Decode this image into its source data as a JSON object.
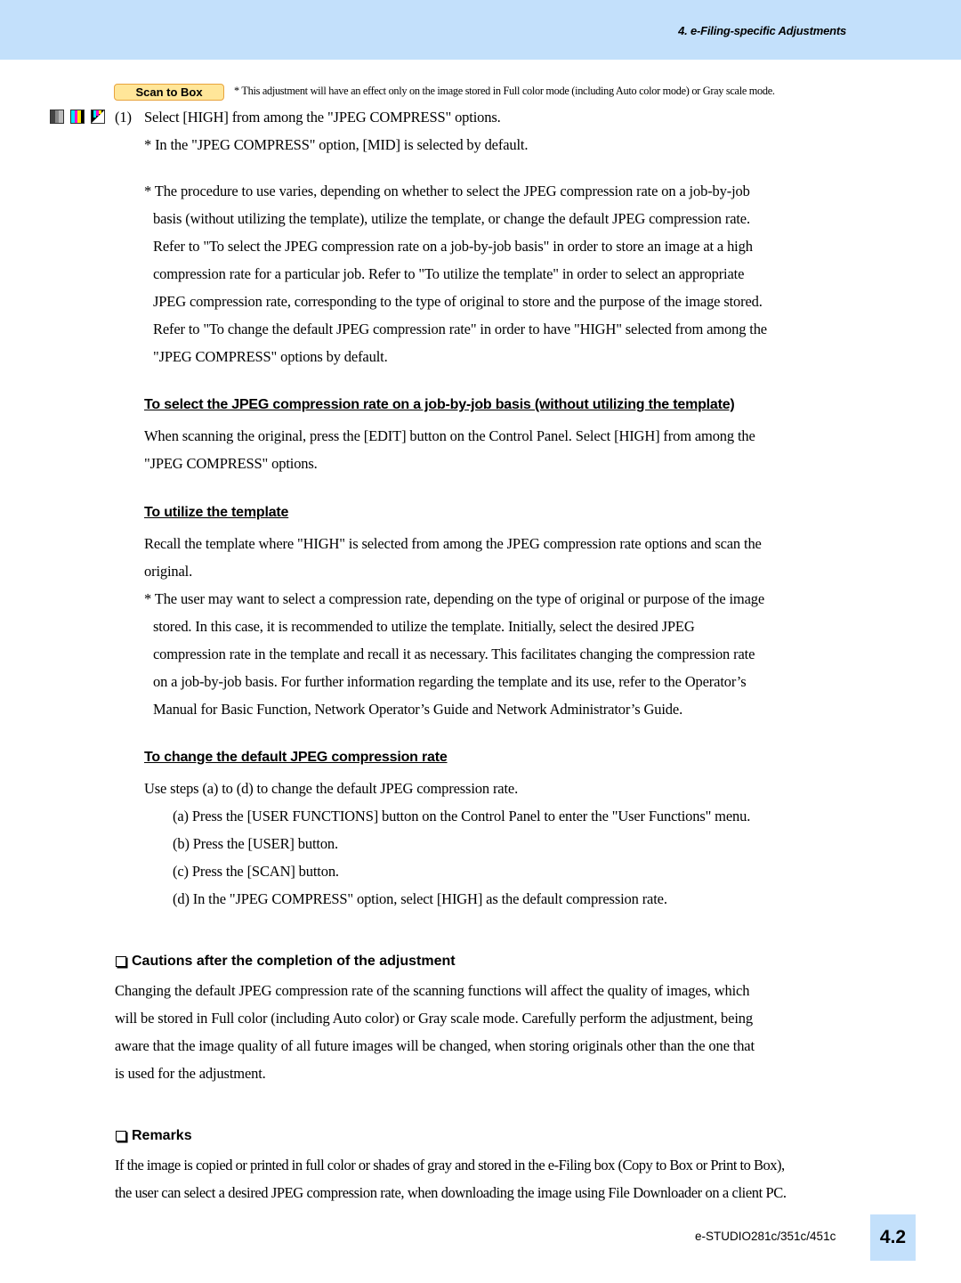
{
  "header": {
    "title": "4. e-Filing-specific Adjustments"
  },
  "badge": {
    "label": "Scan to Box"
  },
  "badge_note": "* This adjustment will have an effect only on the image stored in Full color mode (including Auto color mode) or Gray scale mode.",
  "mode_icons": [
    "black-white-mode-icon",
    "full-color-mode-icon",
    "auto-color-mode-icon"
  ],
  "step1": {
    "number": "(1)",
    "text": "Select [HIGH] from among the \"JPEG COMPRESS\" options.",
    "note": "* In the \"JPEG COMPRESS\" option, [MID] is selected by default."
  },
  "procedure_note": [
    "* The procedure to use varies, depending on whether to select the JPEG compression rate on a job-by-job",
    "basis (without utilizing the template), utilize the template, or change the default JPEG compression rate.",
    "Refer to \"To select the JPEG compression rate on a job-by-job basis\" in order to store an image at a high",
    "compression rate for a particular job.  Refer to \"To utilize the template\" in order to select an appropriate",
    "JPEG compression rate, corresponding to the type of original to store and the purpose of the image stored.",
    "Refer to \"To change the default JPEG compression rate\" in order to have \"HIGH\" selected from among the",
    "\"JPEG COMPRESS\" options by default."
  ],
  "section_jobbyjob": {
    "heading": "To select the JPEG compression rate on a job-by-job basis (without utilizing the template)",
    "lines": [
      "When scanning the original, press the [EDIT] button on the Control Panel.  Select [HIGH] from among the",
      "\"JPEG COMPRESS\" options."
    ]
  },
  "section_template": {
    "heading": "To utilize the template",
    "lines": [
      "Recall the template where \"HIGH\" is selected from among the JPEG compression rate options and scan the",
      "original."
    ],
    "note": [
      "* The user may want to select a compression rate, depending on the type of original or purpose of the image",
      "stored.  In this case, it is recommended to utilize the template.  Initially, select the desired JPEG",
      "compression rate in the template and recall it as necessary.  This facilitates changing the compression rate",
      "on a job-by-job basis.  For further information regarding the template and its use, refer to the Operator’s",
      "Manual for Basic Function, Network Operator’s Guide and Network Administrator’s Guide."
    ]
  },
  "section_default": {
    "heading": "To change the default JPEG compression rate",
    "intro": "Use steps (a) to (d) to change the default JPEG compression rate.",
    "steps": [
      "(a) Press the [USER FUNCTIONS] button on the Control Panel to enter the \"User Functions\" menu.",
      "(b) Press the [USER] button.",
      "(c) Press the [SCAN] button.",
      "(d) In the \"JPEG COMPRESS\" option, select [HIGH] as the default compression rate."
    ]
  },
  "cautions": {
    "heading": "Cautions after the completion of the adjustment",
    "lines": [
      "Changing the default JPEG compression rate of the scanning functions will affect the quality of images, which",
      "will be stored in Full color (including Auto color) or Gray scale mode.  Carefully perform the adjustment, being",
      "aware that the image quality of all future images will be changed, when storing originals other than the one that",
      "is used for the adjustment."
    ]
  },
  "remarks": {
    "heading": "Remarks",
    "lines": [
      "If the image is copied or printed in full color or shades of gray and stored in the e-Filing box (Copy to Box or Print to Box),",
      "the user can select a desired JPEG compression rate, when downloading the image using File Downloader on a client PC."
    ]
  },
  "footer": {
    "model": "e-STUDIO281c/351c/451c",
    "page_tab": "4.2"
  },
  "colors": {
    "header_band": "#c3e0fb",
    "badge_fill": "#ffe699",
    "badge_border": "#e8a33c"
  }
}
